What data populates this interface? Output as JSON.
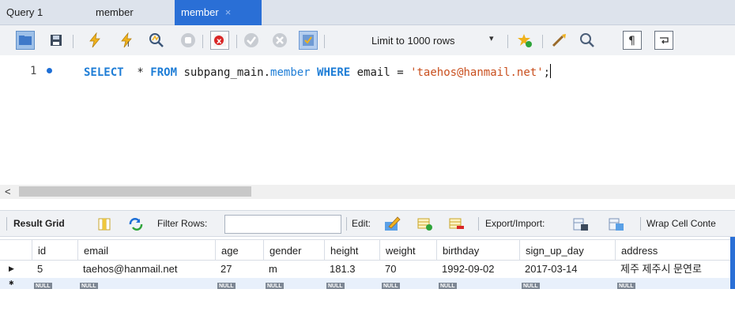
{
  "tabs": [
    {
      "label": "Query 1",
      "active": false
    },
    {
      "label": "member",
      "active": false
    },
    {
      "label": "member",
      "active": true,
      "close": "×"
    }
  ],
  "toolbar": {
    "icons": [
      "open-folder",
      "save",
      "execute",
      "execute-current",
      "explain",
      "stop",
      "toggle-error-stop",
      "commit",
      "rollback",
      "autocommit",
      "beautify",
      "find",
      "invisible-chars",
      "word-wrap"
    ],
    "limit_label": "Limit to 1000 rows",
    "limit_caret": "▾"
  },
  "editor": {
    "line_number": "1",
    "tokens": [
      {
        "t": "SELECT",
        "c": "kw"
      },
      {
        "t": "  * ",
        "c": ""
      },
      {
        "t": "FROM",
        "c": "kw"
      },
      {
        "t": " subpang_main.",
        "c": ""
      },
      {
        "t": "member",
        "c": "kw2"
      },
      {
        "t": " ",
        "c": ""
      },
      {
        "t": "WHERE",
        "c": "kw"
      },
      {
        "t": " email = ",
        "c": ""
      },
      {
        "t": "'taehos@hanmail.net'",
        "c": "str"
      },
      {
        "t": ";",
        "c": ""
      }
    ]
  },
  "scrollbar": {
    "left_arrow": "<"
  },
  "result_toolbar": {
    "result_grid": "Result Grid",
    "filter_rows": "Filter Rows:",
    "edit": "Edit:",
    "export_import": "Export/Import:",
    "wrap": "Wrap Cell Conte"
  },
  "grid": {
    "columns": [
      "id",
      "email",
      "age",
      "gender",
      "height",
      "weight",
      "birthday",
      "sign_up_day",
      "address"
    ],
    "rows": [
      [
        "5",
        "taehos@hanmail.net",
        "27",
        "m",
        "181.3",
        "70",
        "1992-09-02",
        "2017-03-14",
        "제주 제주시 문연로"
      ]
    ],
    "null_label": "NULL",
    "current_marker": "▶",
    "new_marker": "✱"
  },
  "colors": {
    "accent": "#2a6fd6",
    "keyword": "#1e7dd6",
    "string": "#c9501f"
  }
}
